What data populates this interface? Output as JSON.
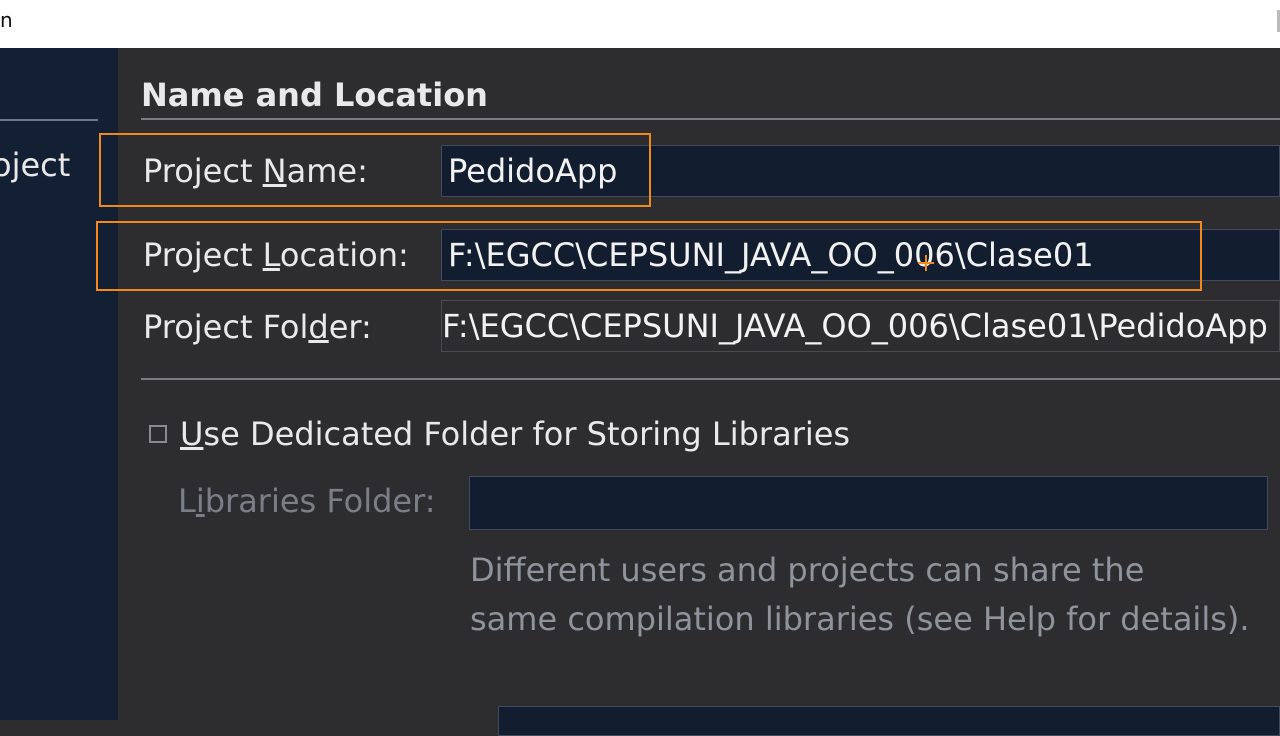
{
  "window": {
    "title_fragment": "n"
  },
  "left_panel": {
    "item_fragment": "oject"
  },
  "section": {
    "title": "Name and Location"
  },
  "project_name": {
    "label": "Project Name:",
    "value": "PedidoApp"
  },
  "project_location": {
    "label": "Project Location:",
    "value": "F:\\EGCC\\CEPSUNI_JAVA_OO_006\\Clase01"
  },
  "project_folder": {
    "label": "Project Folder:",
    "value": "F:\\EGCC\\CEPSUNI_JAVA_OO_006\\Clase01\\PedidoApp"
  },
  "libraries": {
    "checkbox_label": "Use Dedicated Folder for Storing Libraries",
    "checked": false,
    "folder_label": "Libraries Folder:",
    "folder_value": "",
    "help_line1": "Different users and projects can share the",
    "help_line2": "same compilation libraries (see Help for details)."
  },
  "colors": {
    "highlight": "#f08a1c",
    "field_bg": "#121e30",
    "panel_bg": "#2d2d30"
  },
  "icons": {
    "cursor": "crosshair-cursor-icon"
  }
}
